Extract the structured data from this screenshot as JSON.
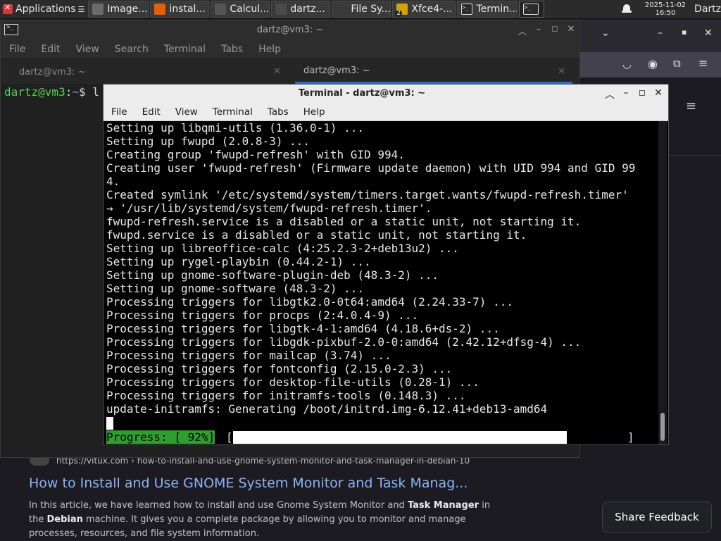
{
  "panel": {
    "apps_label": "Applications",
    "tasks": [
      {
        "label": "Image...",
        "icon": "image-viewer-icon",
        "color": "#6b6b6b"
      },
      {
        "label": "instal...",
        "icon": "firefox-icon",
        "color": "#e66000"
      },
      {
        "label": "Calcul...",
        "icon": "calculator-icon",
        "color": "#555555"
      },
      {
        "label": "dartz...",
        "icon": "image-icon",
        "color": "#4a4a4a"
      },
      {
        "label": "File Sy...",
        "icon": "folder-icon",
        "color": "#3a3a3a"
      },
      {
        "label": "Xfce4-...",
        "icon": "star-badge-icon",
        "color": "#d4a300",
        "badge": "2"
      },
      {
        "label": "Termin...",
        "icon": "terminal-icon",
        "color": "#2a2a2a"
      },
      {
        "label": "",
        "icon": "terminal-icon",
        "color": "#2a2a2a"
      }
    ],
    "date": "2025-11-02",
    "time": "16:50",
    "user": "Dartz"
  },
  "back_terminal": {
    "title": "dartz@vm3: ~",
    "menu": [
      "File",
      "Edit",
      "View",
      "Search",
      "Terminal",
      "Tabs",
      "Help"
    ],
    "tabs": [
      "dartz@vm3: ~",
      "dartz@vm3: ~"
    ],
    "prompt_user": "dartz@vm3",
    "prompt_sep": ":",
    "prompt_path": "~",
    "prompt_end": "$ l"
  },
  "front_terminal": {
    "title": "Terminal - dartz@vm3: ~",
    "menu": [
      "File",
      "Edit",
      "View",
      "Terminal",
      "Tabs",
      "Help"
    ],
    "lines": [
      "Setting up libqmi-utils (1.36.0-1) ...",
      "Setting up fwupd (2.0.8-3) ...",
      "Creating group 'fwupd-refresh' with GID 994.",
      "Creating user 'fwupd-refresh' (Firmware update daemon) with UID 994 and GID 99",
      "4.",
      "Created symlink '/etc/systemd/system/timers.target.wants/fwupd-refresh.timer'",
      "→ '/usr/lib/systemd/system/fwupd-refresh.timer'.",
      "fwupd-refresh.service is a disabled or a static unit, not starting it.",
      "fwupd.service is a disabled or a static unit, not starting it.",
      "Setting up libreoffice-calc (4:25.2.3-2+deb13u2) ...",
      "Setting up rygel-playbin (0.44.2-1) ...",
      "Setting up gnome-software-plugin-deb (48.3-2) ...",
      "Setting up gnome-software (48.3-2) ...",
      "Processing triggers for libgtk2.0-0t64:amd64 (2.24.33-7) ...",
      "Processing triggers for procps (2:4.0.4-9) ...",
      "Processing triggers for libgtk-4-1:amd64 (4.18.6+ds-2) ...",
      "Processing triggers for libgdk-pixbuf-2.0-0:amd64 (2.42.12+dfsg-4) ...",
      "Processing triggers for mailcap (3.74) ...",
      "Processing triggers for fontconfig (2.15.0-2.3) ...",
      "Processing triggers for desktop-file-utils (0.28-1) ...",
      "Processing triggers for initramfs-tools (0.148.3) ...",
      "update-initramfs: Generating /boot/initrd.img-6.12.41+deb13-amd64"
    ],
    "progress_label": "Progress: [ 92%]",
    "progress_open": "[",
    "progress_close": "]",
    "progress_fraction": 0.92
  },
  "browser": {
    "result_url": "https://vitux.com › how-to-install-and-use-gnome-system-monitor-and-task-manager-in-debian-10",
    "result_title": "How to Install and Use GNOME System Monitor and Task Manag...",
    "desc_1": "In this article, we have learned how to install and use Gnome System Monitor and ",
    "desc_bold_1": "Task Manager",
    "desc_2": " in the ",
    "desc_bold_2": "Debian",
    "desc_3": " machine. It gives you a complete package by allowing you to monitor and manage processes, resources, and file system information.",
    "share_label": "Share Feedback"
  }
}
